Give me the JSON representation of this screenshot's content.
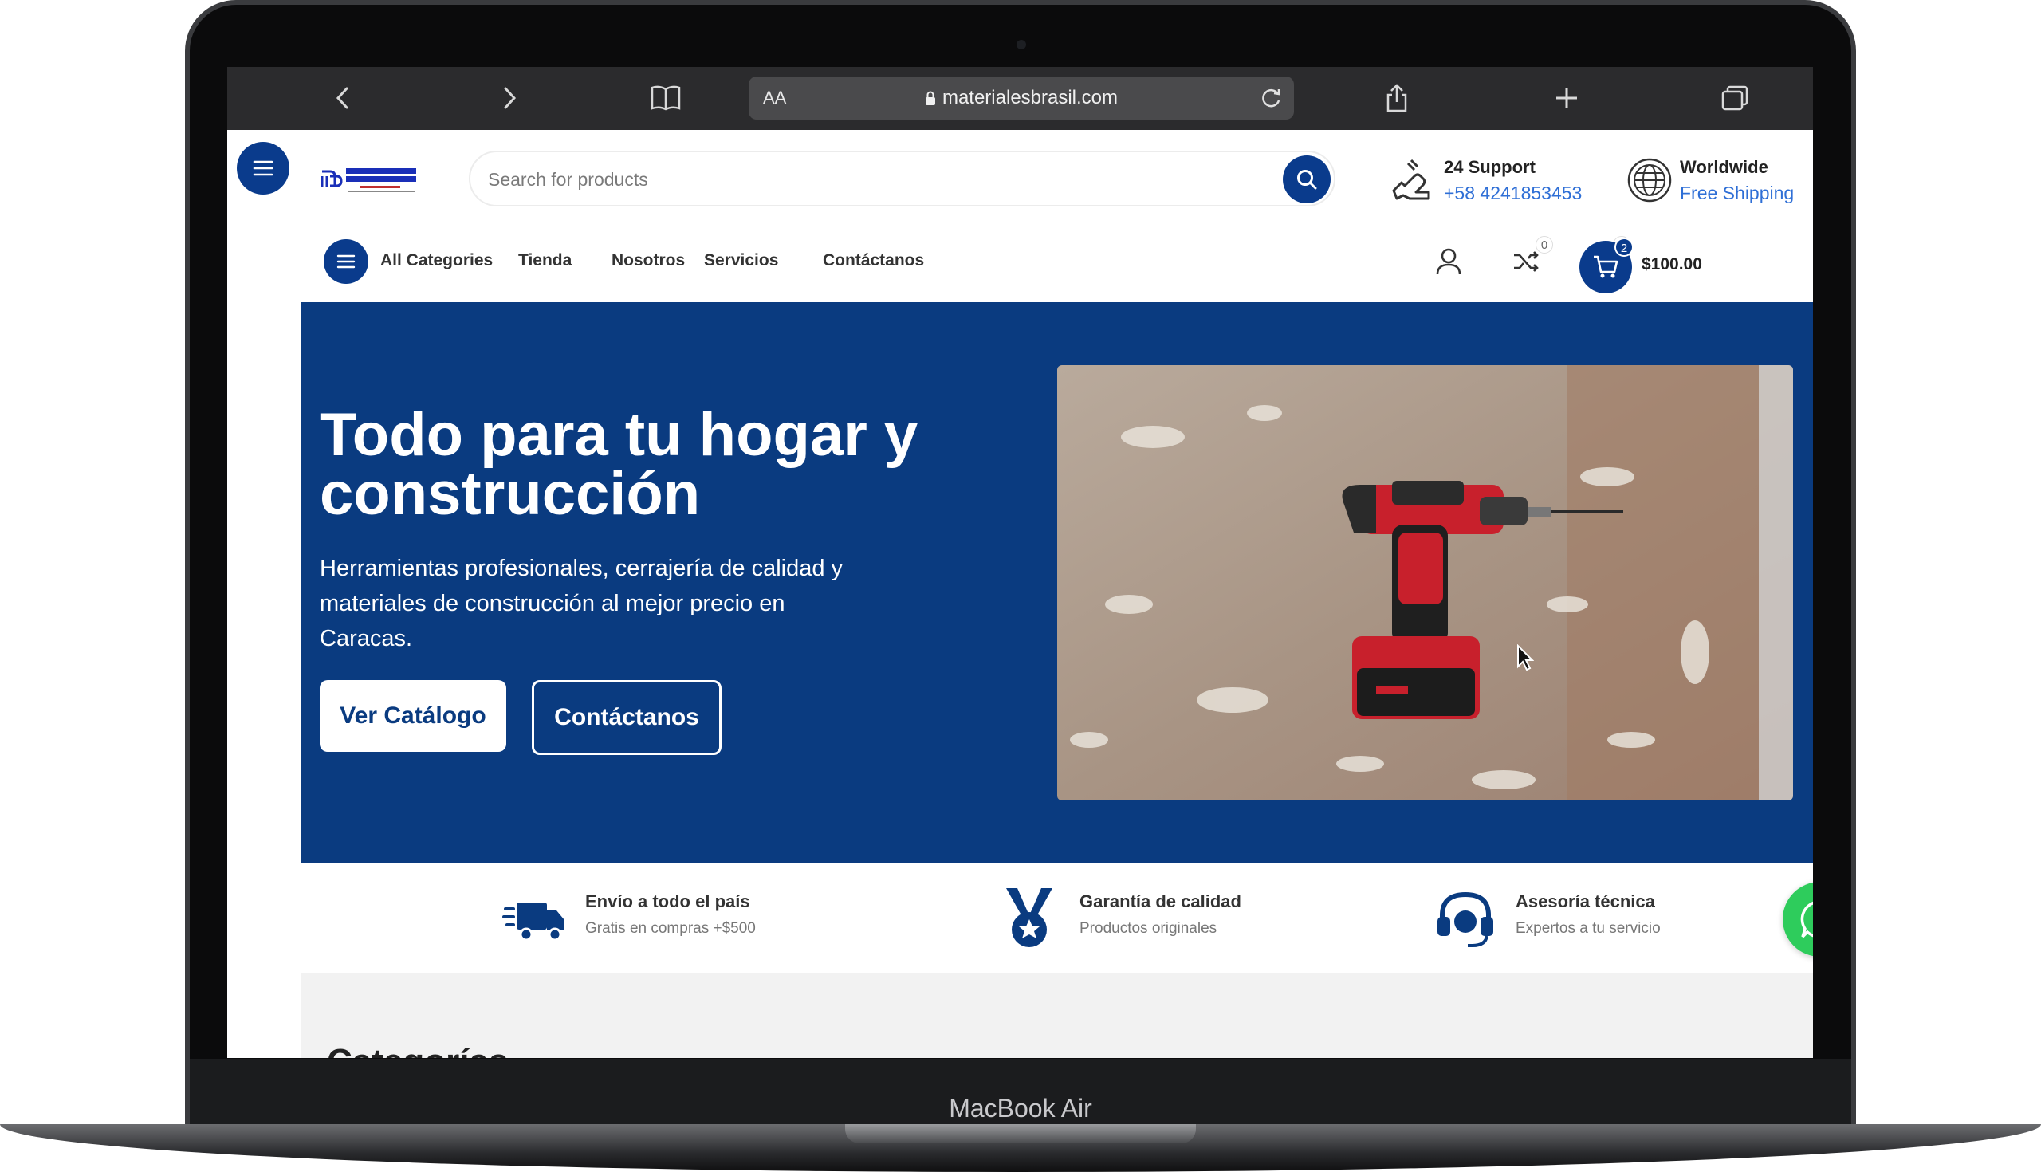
{
  "device": {
    "label": "MacBook Air"
  },
  "browser": {
    "text_size_label": "AA",
    "url": "materialesbrasil.com"
  },
  "header": {
    "logo_text": "MATERIALES BRASIL, C.A.",
    "search": {
      "placeholder": "Search for products"
    },
    "support": {
      "title": "24 Support",
      "phone": "+58 4241853453"
    },
    "shipping": {
      "title": "Worldwide",
      "subtitle": "Free Shipping"
    }
  },
  "nav": {
    "all_categories": "All Categories",
    "links": [
      "Tienda",
      "Nosotros",
      "Servicios",
      "Contáctanos"
    ],
    "compare_count": "0",
    "wishlist_count": "0",
    "cart_count": "2",
    "cart_total": "$100.00"
  },
  "hero": {
    "title": "Todo para tu hogar y construcción",
    "subtitle": "Herramientas profesionales, cerrajería de calidad y materiales de construcción al mejor precio en Caracas.",
    "primary_button": "Ver Catálogo",
    "secondary_button": "Contáctanos"
  },
  "features": [
    {
      "icon": "truck-icon",
      "title": "Envío a todo el país",
      "subtitle": "Gratis en compras +$500"
    },
    {
      "icon": "medal-icon",
      "title": "Garantía de calidad",
      "subtitle": "Productos originales"
    },
    {
      "icon": "headset-icon",
      "title": "Asesoría técnica",
      "subtitle": "Expertos a tu servicio"
    }
  ],
  "section": {
    "title_partial": "Categorías"
  },
  "colors": {
    "brand": "#0a3b80",
    "accent_link": "#2f6fd6",
    "whatsapp": "#2ecc5c"
  }
}
